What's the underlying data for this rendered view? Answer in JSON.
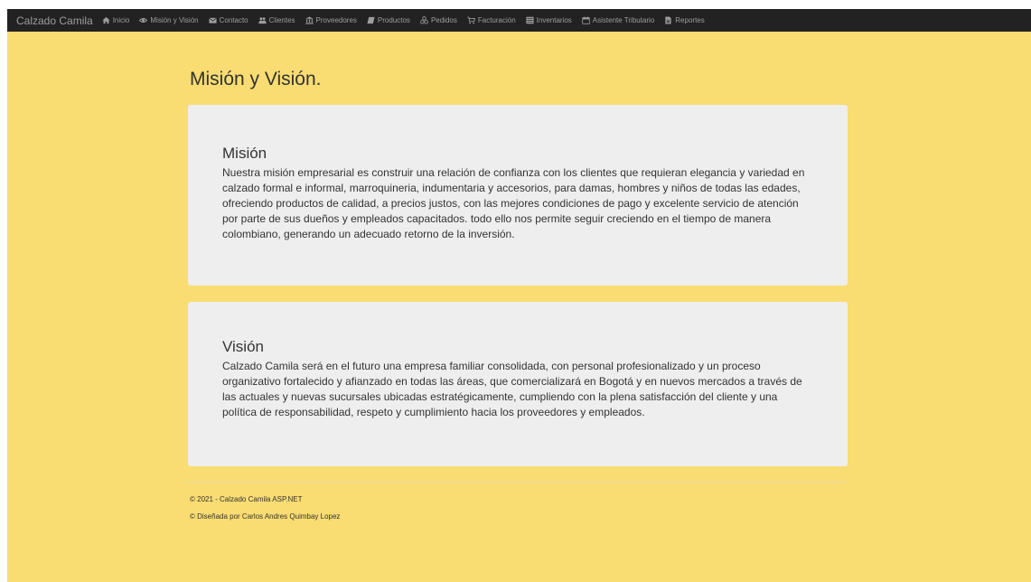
{
  "navbar": {
    "brand": "Calzado Camila",
    "items": [
      {
        "label": "Inicio",
        "icon": "home-icon"
      },
      {
        "label": "Misión y Visión",
        "icon": "eye-icon"
      },
      {
        "label": "Contacto",
        "icon": "envelope-icon"
      },
      {
        "label": "Clientes",
        "icon": "users-icon"
      },
      {
        "label": "Proveedores",
        "icon": "bank-icon"
      },
      {
        "label": "Productos",
        "icon": "book-icon"
      },
      {
        "label": "Pedidos",
        "icon": "boxes-icon"
      },
      {
        "label": "Facturación",
        "icon": "cart-icon"
      },
      {
        "label": "Inventarios",
        "icon": "list-icon"
      },
      {
        "label": "Asistente Tributario",
        "icon": "calendar-icon"
      },
      {
        "label": "Reportes",
        "icon": "file-icon"
      }
    ]
  },
  "main": {
    "title": "Misión y Visión.",
    "mision": {
      "heading": "Misión",
      "text": "Nuestra misión empresarial es construir una relación de confianza con los clientes que requieran elegancia y variedad en calzado formal e informal, marroquineria, indumentaria y accesorios, para damas, hombres y niños de todas las edades, ofreciendo productos de calidad, a precios justos, con las mejores condiciones de pago y excelente servicio de atención por parte de sus dueños y empleados capacitados. todo ello nos permite seguir creciendo en el tiempo de manera colombiano, generando un adecuado retorno de la inversión."
    },
    "vision": {
      "heading": "Visión",
      "text": "Calzado Camila será en el futuro una empresa familiar consolidada, con personal profesionalizado y un proceso organizativo fortalecido y afianzado en todas las áreas, que comercializará en Bogotá y en nuevos mercados a través de las actuales y nuevas sucursales ubicadas estratégicamente, cumpliendo con la plena satisfacción del cliente y una política de responsabilidad, respeto y cumplimiento hacia los proveedores y empleados."
    }
  },
  "footer": {
    "copyright": "© 2021 - Calzado Camila ASP.NET",
    "designer": "© Diseñada por Carlos Andres Quimbay Lopez"
  },
  "colors": {
    "navbar_bg": "#222222",
    "page_bg": "#f9dc72",
    "card_bg": "#eeeeee",
    "text": "#333333"
  }
}
